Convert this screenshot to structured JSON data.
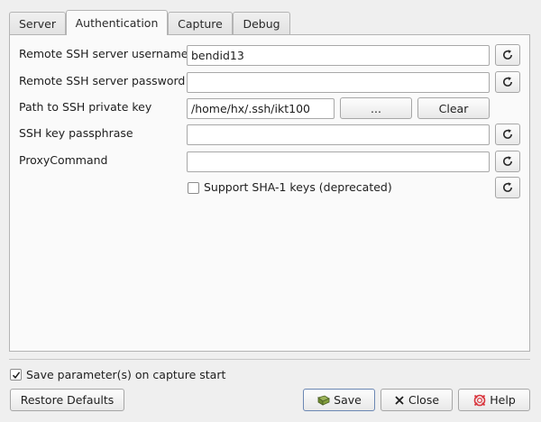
{
  "tabs": [
    {
      "label": "Server",
      "active": false
    },
    {
      "label": "Authentication",
      "active": true
    },
    {
      "label": "Capture",
      "active": false
    },
    {
      "label": "Debug",
      "active": false
    }
  ],
  "auth": {
    "username": {
      "label": "Remote SSH server username",
      "value": "bendid13"
    },
    "password": {
      "label": "Remote SSH server password",
      "value": ""
    },
    "private_key": {
      "label": "Path to SSH private key",
      "value": "/home/hx/.ssh/ikt100",
      "browse_label": "...",
      "clear_label": "Clear"
    },
    "passphrase": {
      "label": "SSH key passphrase",
      "value": ""
    },
    "proxy_command": {
      "label": "ProxyCommand",
      "value": ""
    },
    "sha1": {
      "label": "Support SHA-1 keys (deprecated)",
      "checked": false
    }
  },
  "footer": {
    "save_on_start": {
      "label": "Save parameter(s) on capture start",
      "checked": true
    },
    "restore_defaults_label": "Restore Defaults",
    "save_label": "Save",
    "close_label": "Close",
    "help_label": "Help"
  },
  "icons": {
    "reset": "reset-icon",
    "save": "save-icon",
    "close": "close-icon",
    "help": "help-icon"
  },
  "colors": {
    "window_bg": "#efefef",
    "panel_bg": "#fafafa",
    "help_icon": "#d9363e",
    "save_icon": "#5a7a2a"
  }
}
